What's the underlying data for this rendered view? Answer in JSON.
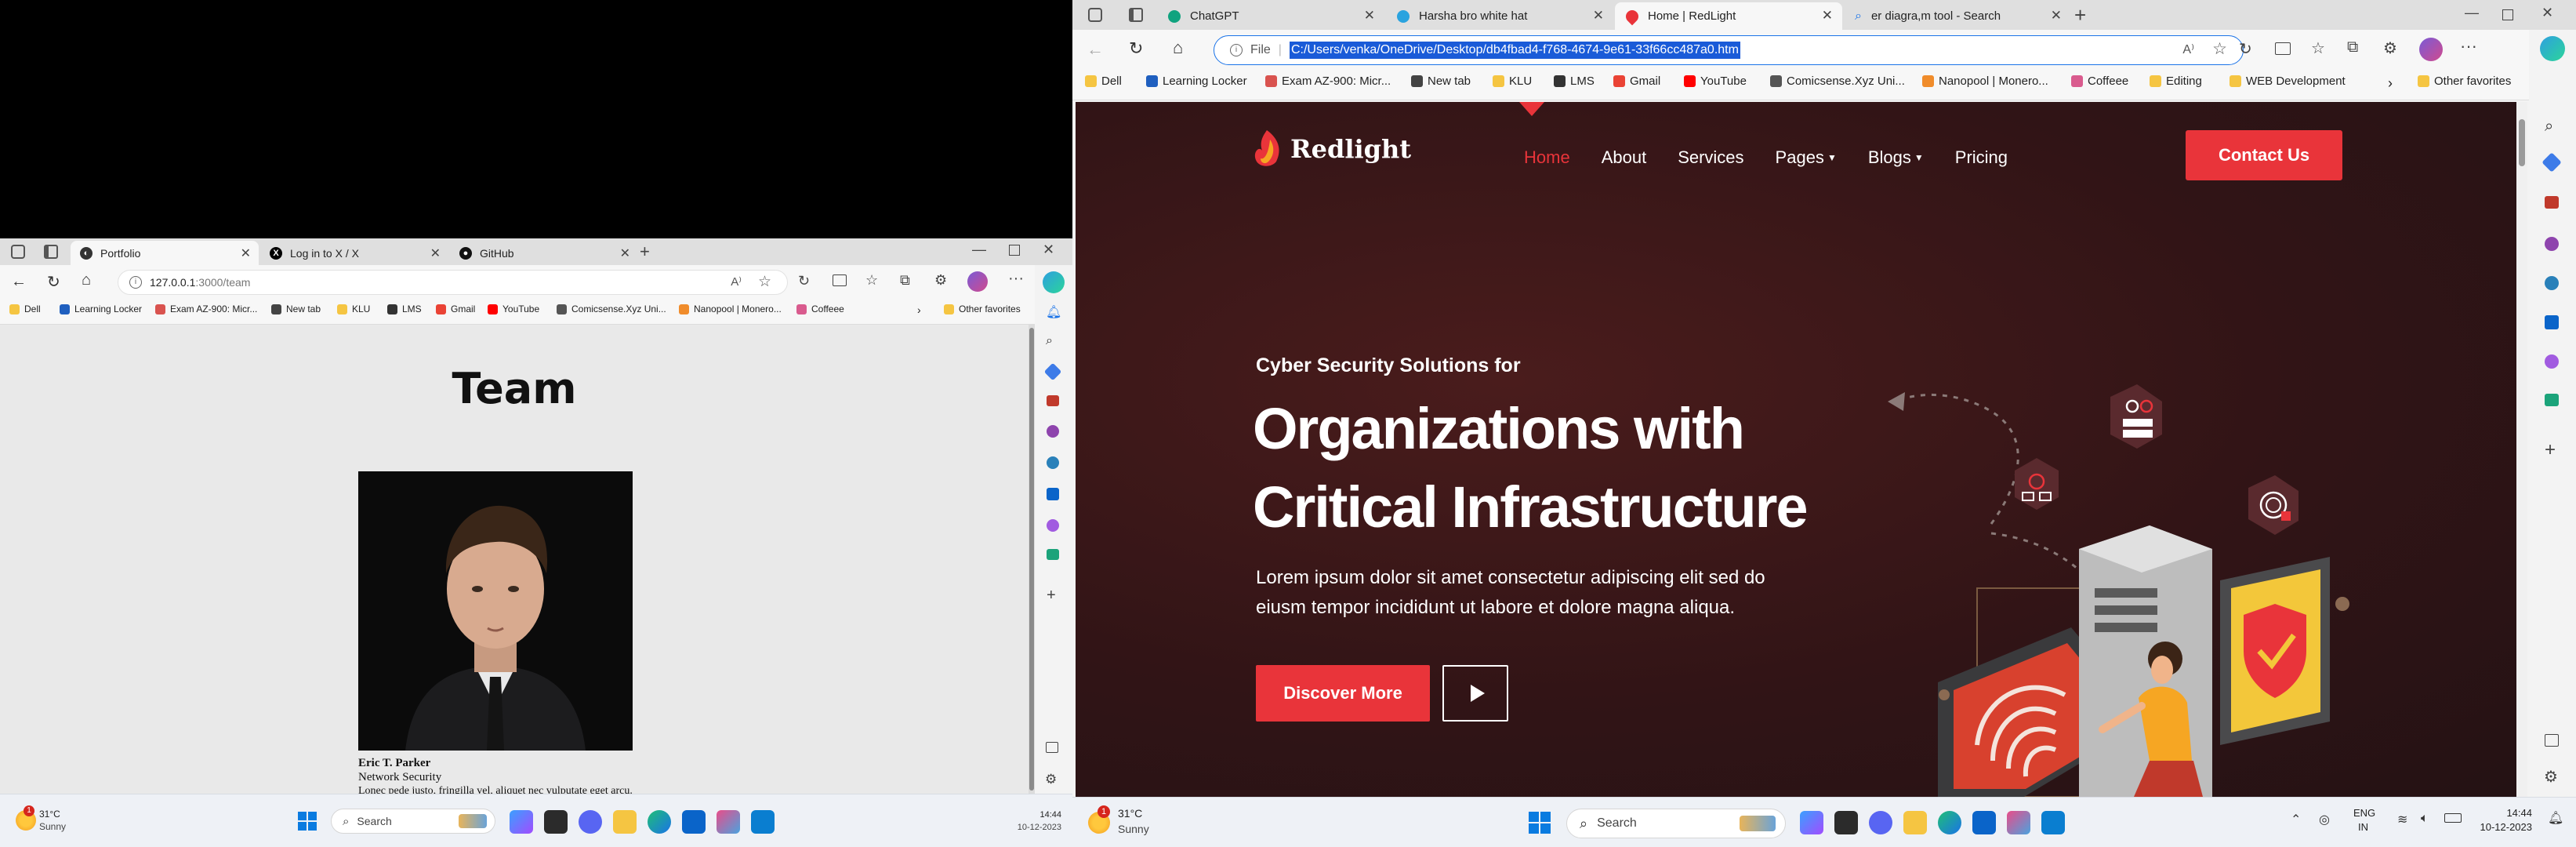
{
  "left_browser": {
    "tabs": [
      {
        "title": "Portfolio",
        "active": true
      },
      {
        "title": "Log in to X / X",
        "active": false
      },
      {
        "title": "GitHub",
        "active": false
      }
    ],
    "url_host": "127.0.0.1",
    "url_rest": ":3000/team",
    "favorites": [
      "Dell",
      "Learning Locker",
      "Exam AZ-900: Micr...",
      "New tab",
      "KLU",
      "LMS",
      "Gmail",
      "YouTube",
      "Comicsense.Xyz Uni...",
      "Nanopool | Monero...",
      "Coffeee"
    ],
    "other_favorites": "Other favorites",
    "page": {
      "heading": "Team",
      "member_name": "Eric T. Parker",
      "member_role": "Network Security",
      "member_bio": "Lonec pede justo, fringilla vel, aliquet nec vulputate eget arcu."
    }
  },
  "left_taskbar": {
    "weather_temp": "31°C",
    "weather_desc": "Sunny",
    "weather_badge": "1",
    "search_placeholder": "Search",
    "time": "14:44",
    "date": "10-12-2023"
  },
  "right_browser": {
    "tabs": [
      {
        "title": "ChatGPT",
        "active": false
      },
      {
        "title": "Harsha bro white hat",
        "active": false
      },
      {
        "title": "Home | RedLight",
        "active": true
      },
      {
        "title": "er diagra,m tool - Search",
        "active": false
      }
    ],
    "url_scheme": "File",
    "url": "C:/Users/venka/OneDrive/Desktop/db4fbad4-f768-4674-9e61-33f66cc487a0.htm",
    "favorites": [
      "Dell",
      "Learning Locker",
      "Exam AZ-900: Micr...",
      "New tab",
      "KLU",
      "LMS",
      "Gmail",
      "YouTube",
      "Comicsense.Xyz Uni...",
      "Nanopool | Monero...",
      "Coffeee",
      "Editing",
      "WEB Development"
    ],
    "other_favorites": "Other favorites",
    "site": {
      "brand": "Redlight",
      "nav": [
        "Home",
        "About",
        "Services",
        "Pages",
        "Blogs",
        "Pricing"
      ],
      "contact_button": "Contact Us",
      "eyebrow": "Cyber Security Solutions for",
      "headline_1": "Organizations with",
      "headline_2": "Critical Infrastructure",
      "lead": "Lorem ipsum dolor sit amet consectetur adipiscing elit sed do eiusm tempor incididunt ut labore et dolore magna aliqua.",
      "discover_button": "Discover More"
    }
  },
  "right_taskbar": {
    "weather_temp": "31°C",
    "weather_desc": "Sunny",
    "weather_badge": "1",
    "search_placeholder": "Search",
    "lang_1": "ENG",
    "lang_2": "IN",
    "time": "14:44",
    "date": "10-12-2023"
  },
  "colors": {
    "accent_red": "#e9343a",
    "site_bg": "#311416",
    "edge_blue": "#1a73e8"
  }
}
